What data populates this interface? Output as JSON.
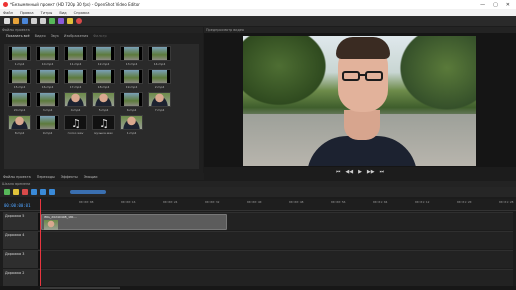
{
  "window": {
    "title": "*Безымянный проект (HD 720p 30 fps) - OpenShot Video Editor",
    "minimize": "—",
    "maximize": "▢",
    "close": "✕"
  },
  "menu": [
    "Файл",
    "Правка",
    "Титры",
    "Вид",
    "Справка"
  ],
  "project_files": {
    "header": "Файлы проекта",
    "tabs": [
      "Показать всё",
      "Видео",
      "Звук",
      "Изображения"
    ],
    "filter_placeholder": "Фильтр",
    "items": [
      {
        "label": "1.mp4",
        "type": "film"
      },
      {
        "label": "10.mp4",
        "type": "film"
      },
      {
        "label": "11.mp4",
        "type": "film"
      },
      {
        "label": "12.mp4",
        "type": "film"
      },
      {
        "label": "13.mp4",
        "type": "film"
      },
      {
        "label": "14.mp4",
        "type": "film"
      },
      {
        "label": "15.mp4",
        "type": "film"
      },
      {
        "label": "16.mp4",
        "type": "film"
      },
      {
        "label": "17.mp4",
        "type": "film"
      },
      {
        "label": "18.mp4",
        "type": "film"
      },
      {
        "label": "19.mp4",
        "type": "film"
      },
      {
        "label": "2.mp4",
        "type": "film"
      },
      {
        "label": "20.mp4",
        "type": "film"
      },
      {
        "label": "3.mp4",
        "type": "film"
      },
      {
        "label": "4.mp4",
        "type": "person"
      },
      {
        "label": "5.mp4",
        "type": "person"
      },
      {
        "label": "6.mp4",
        "type": "film"
      },
      {
        "label": "7.mp4",
        "type": "person"
      },
      {
        "label": "8.mp4",
        "type": "person"
      },
      {
        "label": "9.mp4",
        "type": "film"
      },
      {
        "label": "голос.wav",
        "type": "audio"
      },
      {
        "label": "музыка.wav",
        "type": "audio"
      },
      {
        "label": "1.mp4",
        "type": "person"
      }
    ]
  },
  "preview": {
    "header": "Предпросмотр видео",
    "controls": [
      "⏮",
      "◀◀",
      "▶",
      "▶▶",
      "⏭"
    ]
  },
  "bottom_tabs": [
    "Файлы проекта",
    "Переходы",
    "Эффекты",
    "Эмоции"
  ],
  "timeline": {
    "header": "Шкала времени",
    "timecode": "00:00:00:01",
    "ticks": [
      "00:00:08",
      "00:00:16",
      "00:00:24",
      "00:00:32",
      "00:00:40",
      "00:00:48",
      "00:00:56",
      "00:01:04",
      "00:01:12",
      "00:01:20",
      "00:01:28"
    ],
    "tracks": [
      {
        "name": "Дорожка 5",
        "clip": "IMG_20240408_181..."
      },
      {
        "name": "Дорожка 4"
      },
      {
        "name": "Дорожка 3"
      },
      {
        "name": "Дорожка 2"
      },
      {
        "name": "Дорожка 1"
      }
    ]
  },
  "colors": {
    "accent": "#4fa3ff",
    "playhead": "#e8353f",
    "clip": "#5c5c5c"
  }
}
